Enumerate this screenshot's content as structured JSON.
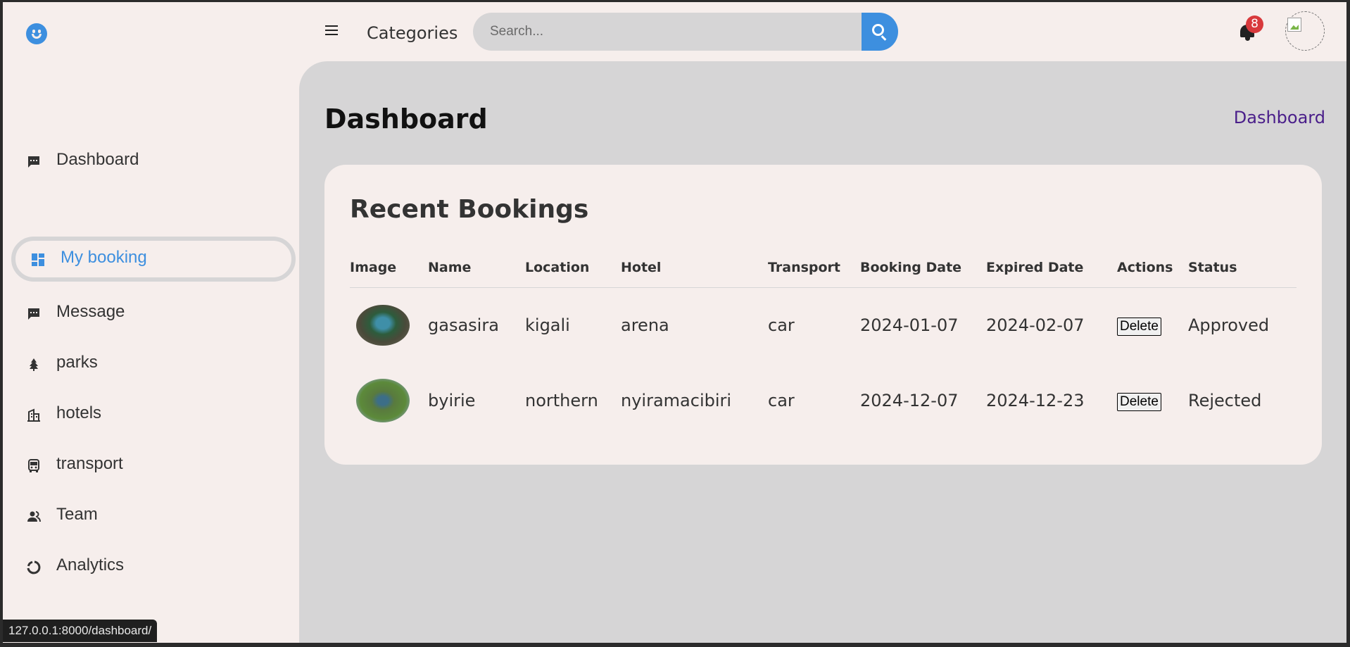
{
  "header": {
    "categories_label": "Categories",
    "search_placeholder": "Search...",
    "notification_count": "8"
  },
  "sidebar": {
    "items": [
      {
        "label": "Dashboard",
        "icon": "message-icon",
        "active": false
      },
      {
        "label": "My booking",
        "icon": "dashboard-grid-icon",
        "active": true
      },
      {
        "label": "Message",
        "icon": "message-icon",
        "active": false
      },
      {
        "label": "parks",
        "icon": "tree-icon",
        "active": false
      },
      {
        "label": "hotels",
        "icon": "building-icon",
        "active": false
      },
      {
        "label": "transport",
        "icon": "bus-icon",
        "active": false
      },
      {
        "label": "Team",
        "icon": "team-icon",
        "active": false
      },
      {
        "label": "Analytics",
        "icon": "pie-chart-icon",
        "active": false
      }
    ]
  },
  "main": {
    "title": "Dashboard",
    "breadcrumb": "Dashboard",
    "card_title": "Recent Bookings",
    "columns": [
      "Image",
      "Name",
      "Location",
      "Hotel",
      "Transport",
      "Booking Date",
      "Expired Date",
      "Actions",
      "Status"
    ],
    "rows": [
      {
        "name": "gasasira",
        "location": "kigali",
        "hotel": "arena",
        "transport": "car",
        "booking_date": "2024-01-07",
        "expired_date": "2024-02-07",
        "action": "Delete",
        "status": "Approved"
      },
      {
        "name": "byirie",
        "location": "northern",
        "hotel": "nyiramacibiri",
        "transport": "car",
        "booking_date": "2024-12-07",
        "expired_date": "2024-12-23",
        "action": "Delete",
        "status": "Rejected"
      }
    ]
  },
  "status_bar": {
    "url": "127.0.0.1:8000/dashboard/"
  },
  "colors": {
    "accent": "#3d8fdf",
    "badge": "#d8393c",
    "breadcrumb": "#4a1e8a",
    "background": "#f6eeec",
    "panel": "#d6d5d6"
  }
}
